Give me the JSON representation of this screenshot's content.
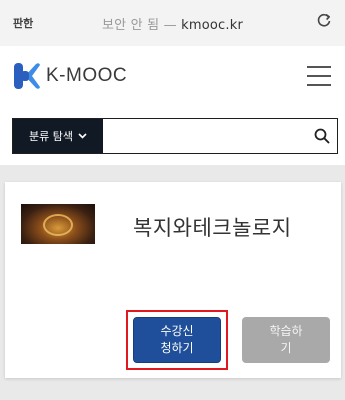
{
  "browser": {
    "reader_label": "판한",
    "secure_label": "보안 안 됨 —",
    "url": "kmooc.kr",
    "reload_icon": "reload-icon"
  },
  "header": {
    "logo_text": "K-MOOC",
    "menu_icon": "hamburger-menu-icon",
    "brand_color": "#2b5fbf"
  },
  "search": {
    "category_label": "분류 탐색",
    "category_icon": "chevron-down-icon",
    "input_value": "",
    "placeholder": "",
    "search_icon": "search-icon"
  },
  "course": {
    "title": "복지와테크놀로지",
    "thumbnail_icon": "course-thumbnail",
    "enroll_label_line1": "수강신",
    "enroll_label_line2": "청하기",
    "study_label_line1": "학습하",
    "study_label_line2": "기",
    "enroll_color": "#1f4f9a",
    "study_color": "#a9a9a9",
    "highlight_color": "#e0191e"
  }
}
